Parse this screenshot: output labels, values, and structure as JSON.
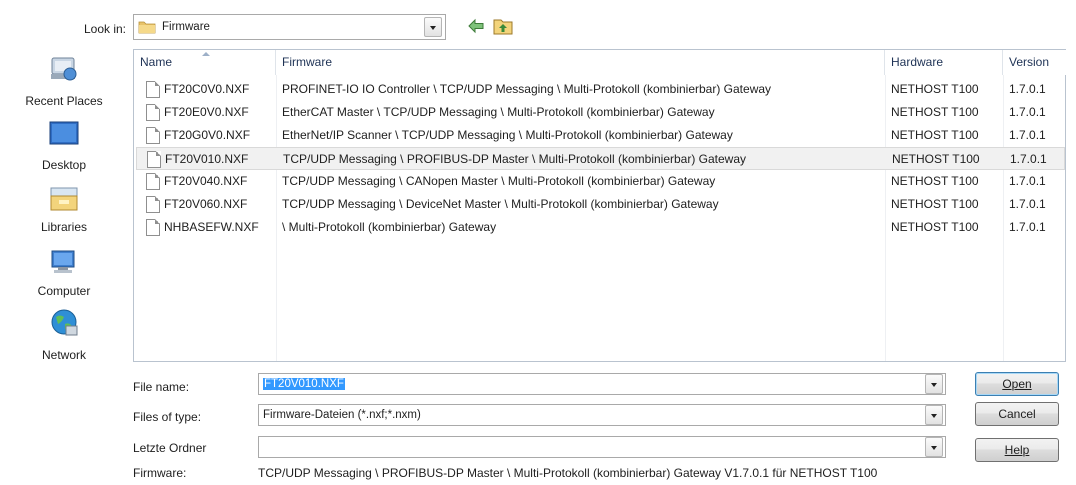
{
  "look_in": {
    "label": "Look in:",
    "value": "Firmware",
    "icons": [
      "folder-icon",
      "back-arrow-icon",
      "up-folder-icon"
    ]
  },
  "places": [
    {
      "label": "Recent Places",
      "icon": "recent-places-icon"
    },
    {
      "label": "Desktop",
      "icon": "desktop-icon"
    },
    {
      "label": "Libraries",
      "icon": "libraries-icon"
    },
    {
      "label": "Computer",
      "icon": "computer-icon"
    },
    {
      "label": "Network",
      "icon": "network-icon"
    }
  ],
  "columns": [
    "Name",
    "Firmware",
    "Hardware",
    "Version"
  ],
  "files": [
    {
      "name": "FT20C0V0.NXF",
      "firmware": "PROFINET-IO IO Controller \\ TCP/UDP Messaging \\ Multi-Protokoll (kombinierbar) Gateway",
      "hardware": "NETHOST T100",
      "version": "1.7.0.1"
    },
    {
      "name": "FT20E0V0.NXF",
      "firmware": "EtherCAT Master \\ TCP/UDP Messaging \\ Multi-Protokoll (kombinierbar) Gateway",
      "hardware": "NETHOST T100",
      "version": "1.7.0.1"
    },
    {
      "name": "FT20G0V0.NXF",
      "firmware": "EtherNet/IP Scanner \\ TCP/UDP Messaging \\ Multi-Protokoll (kombinierbar) Gateway",
      "hardware": "NETHOST T100",
      "version": "1.7.0.1"
    },
    {
      "name": "FT20V010.NXF",
      "firmware": "TCP/UDP Messaging \\ PROFIBUS-DP Master \\ Multi-Protokoll (kombinierbar) Gateway",
      "hardware": "NETHOST T100",
      "version": "1.7.0.1",
      "selected": true
    },
    {
      "name": "FT20V040.NXF",
      "firmware": "TCP/UDP Messaging \\ CANopen Master \\ Multi-Protokoll (kombinierbar) Gateway",
      "hardware": "NETHOST T100",
      "version": "1.7.0.1"
    },
    {
      "name": "FT20V060.NXF",
      "firmware": "TCP/UDP Messaging \\ DeviceNet Master \\ Multi-Protokoll (kombinierbar) Gateway",
      "hardware": "NETHOST T100",
      "version": "1.7.0.1"
    },
    {
      "name": "NHBASEFW.NXF",
      "firmware": " \\ Multi-Protokoll (kombinierbar) Gateway",
      "hardware": "NETHOST T100",
      "version": "1.7.0.1"
    }
  ],
  "form": {
    "file_name_label": "File name:",
    "file_name_value": "FT20V010.NXF",
    "files_of_type_label": "Files of type:",
    "files_of_type_value": "Firmware-Dateien (*.nxf;*.nxm)",
    "recent_folder_label": "Letzte Ordner",
    "recent_folder_value": "",
    "firmware_label": "Firmware:",
    "firmware_value": "TCP/UDP Messaging \\ PROFIBUS-DP Master \\ Multi-Protokoll (kombinierbar) Gateway V1.7.0.1 für NETHOST T100"
  },
  "buttons": {
    "open": "Open",
    "cancel": "Cancel",
    "help": "Help"
  },
  "colors": {
    "selection_highlight": "#3399ff",
    "selected_row": "#f1f1f1",
    "column_header_text": "#1e3255"
  }
}
